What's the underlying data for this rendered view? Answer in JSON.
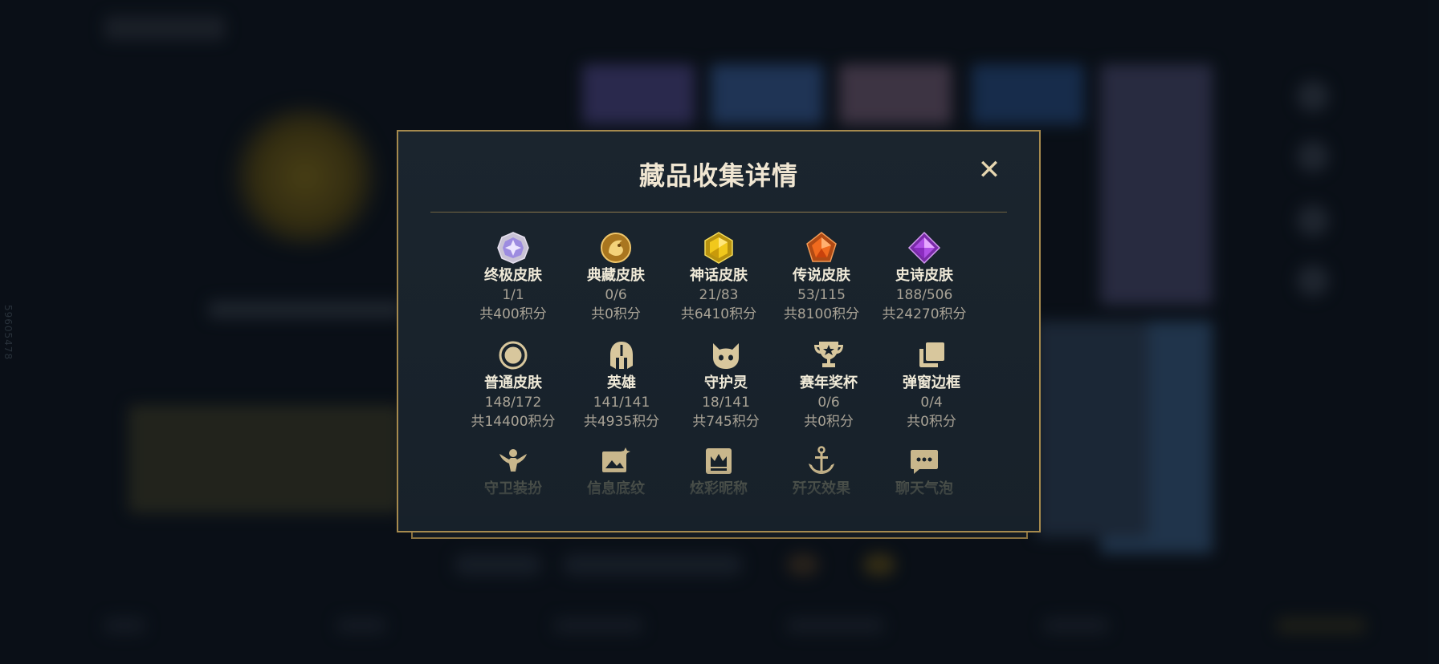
{
  "background": {
    "side_text": "59605478"
  },
  "modal": {
    "title": "藏品收集详情",
    "close_glyph": "✕",
    "rows": [
      [
        {
          "name": "终极皮肤",
          "count": "1/1",
          "score": "共400积分",
          "icon": "ultimate-gem-icon"
        },
        {
          "name": "典藏皮肤",
          "count": "0/6",
          "score": "共0积分",
          "icon": "dragon-emblem-icon"
        },
        {
          "name": "神话皮肤",
          "count": "21/83",
          "score": "共6410积分",
          "icon": "mythic-gem-icon"
        },
        {
          "name": "传说皮肤",
          "count": "53/115",
          "score": "共8100积分",
          "icon": "legendary-gem-icon"
        },
        {
          "name": "史诗皮肤",
          "count": "188/506",
          "score": "共24270积分",
          "icon": "epic-gem-icon"
        }
      ],
      [
        {
          "name": "普通皮肤",
          "count": "148/172",
          "score": "共14400积分",
          "icon": "circle-icon"
        },
        {
          "name": "英雄",
          "count": "141/141",
          "score": "共4935积分",
          "icon": "helmet-icon"
        },
        {
          "name": "守护灵",
          "count": "18/141",
          "score": "共745积分",
          "icon": "guardian-face-icon"
        },
        {
          "name": "赛年奖杯",
          "count": "0/6",
          "score": "共0积分",
          "icon": "trophy-icon"
        },
        {
          "name": "弹窗边框",
          "count": "0/4",
          "score": "共0积分",
          "icon": "frames-icon"
        }
      ],
      [
        {
          "name": "守卫装扮",
          "icon": "ward-icon"
        },
        {
          "name": "信息底纹",
          "icon": "banner-image-icon"
        },
        {
          "name": "炫彩昵称",
          "icon": "crown-card-icon"
        },
        {
          "name": "歼灭效果",
          "icon": "anchor-icon"
        },
        {
          "name": "聊天气泡",
          "icon": "chat-bubble-icon"
        }
      ]
    ]
  },
  "colors": {
    "gold_border": "#a68a4e",
    "icon_gold": "#d8c79d",
    "title": "#f0e6d2"
  }
}
